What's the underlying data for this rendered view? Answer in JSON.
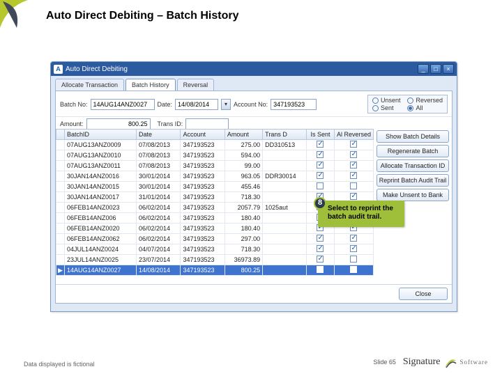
{
  "slide": {
    "title": "Auto Direct Debiting – Batch History",
    "footer_left": "Data displayed is fictional",
    "slide_label": "Slide 65",
    "brand_main": "Signature",
    "brand_sub": "Software"
  },
  "window": {
    "title": "Auto Direct Debiting",
    "tabs": [
      "Allocate Transaction",
      "Batch History",
      "Reversal"
    ],
    "active_tab": 1
  },
  "filters": {
    "batch_no_label": "Batch No:",
    "batch_no": "14AUG14ANZ0027",
    "date_label": "Date:",
    "date": "14/08/2014",
    "account_no_label": "Account No:",
    "account_no": "347193523",
    "amount_label": "Amount:",
    "amount": "800.25",
    "trans_id_label": "Trans ID:",
    "trans_id": ""
  },
  "radio": {
    "unsent": "Unsent",
    "reversed": "Reversed",
    "sent": "Sent",
    "all": "All",
    "selected": "all"
  },
  "grid": {
    "headers": [
      "BatchID",
      "Date",
      "Account",
      "Amount",
      "Trans D",
      "Is Sent",
      "Al Reversed"
    ],
    "rows": [
      {
        "batch": "07AUG13ANZ0009",
        "date": "07/08/2013",
        "acct": "347193523",
        "amt": "275.00",
        "trans": "DD310513",
        "sent": true,
        "rev": true
      },
      {
        "batch": "07AUG13ANZ0010",
        "date": "07/08/2013",
        "acct": "347193523",
        "amt": "594.00",
        "trans": "",
        "sent": true,
        "rev": true
      },
      {
        "batch": "07AUG13ANZ0011",
        "date": "07/08/2013",
        "acct": "347193523",
        "amt": "99.00",
        "trans": "",
        "sent": true,
        "rev": true
      },
      {
        "batch": "30JAN14ANZ0016",
        "date": "30/01/2014",
        "acct": "347193523",
        "amt": "963.05",
        "trans": "DDR30014",
        "sent": true,
        "rev": true
      },
      {
        "batch": "30JAN14ANZ0015",
        "date": "30/01/2014",
        "acct": "347193523",
        "amt": "455.46",
        "trans": "",
        "sent": false,
        "rev": false
      },
      {
        "batch": "30JAN14ANZ0017",
        "date": "31/01/2014",
        "acct": "347193523",
        "amt": "718.30",
        "trans": "",
        "sent": true,
        "rev": true
      },
      {
        "batch": "06FEB14ANZ0023",
        "date": "06/02/2014",
        "acct": "347193523",
        "amt": "2057.79",
        "trans": "1025aut",
        "sent": true,
        "rev": true
      },
      {
        "batch": "06FEB14ANZ006",
        "date": "06/02/2014",
        "acct": "347193523",
        "amt": "180.40",
        "trans": "",
        "sent": true,
        "rev": true
      },
      {
        "batch": "06FEB14ANZ0020",
        "date": "06/02/2014",
        "acct": "347193523",
        "amt": "180.40",
        "trans": "",
        "sent": true,
        "rev": true
      },
      {
        "batch": "06FEB14ANZ0062",
        "date": "06/02/2014",
        "acct": "347193523",
        "amt": "297.00",
        "trans": "",
        "sent": true,
        "rev": true
      },
      {
        "batch": "04JUL14ANZ0024",
        "date": "04/07/2014",
        "acct": "347193523",
        "amt": "718.30",
        "trans": "",
        "sent": true,
        "rev": true
      },
      {
        "batch": "23JUL14ANZ0025",
        "date": "23/07/2014",
        "acct": "347193523",
        "amt": "36973.89",
        "trans": "",
        "sent": true,
        "rev": false
      },
      {
        "batch": "14AUG14ANZ0027",
        "date": "14/08/2014",
        "acct": "347193523",
        "amt": "800.25",
        "trans": "",
        "sent": false,
        "rev": false,
        "selected": true
      }
    ]
  },
  "buttons": {
    "show_details": "Show Batch Details",
    "regenerate": "Regenerate Batch",
    "allocate": "Allocate Transaction ID",
    "reprint": "Reprint Batch Audit Trail",
    "make_unsent": "Make Unsent to Bank",
    "close": "Close"
  },
  "callout": {
    "num": "8",
    "text": "Select to reprint the batch audit trail."
  }
}
